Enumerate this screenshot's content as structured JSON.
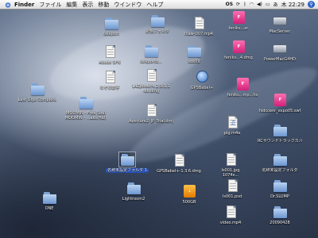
{
  "menubar": {
    "apple": "",
    "app": "Finder",
    "menus": [
      "ファイル",
      "編集",
      "表示",
      "移動",
      "ウインドウ",
      "ヘルプ"
    ],
    "status_os": "OS",
    "clock": "木 22:29"
  },
  "desktop": {
    "icons": [
      {
        "name": "teleport",
        "label": "teleport",
        "kind": "folder"
      },
      {
        "name": "new-folder",
        "label": "新規フォルダ",
        "kind": "folder"
      },
      {
        "name": "hiawatha",
        "label": "hiaw-007.mp4",
        "kind": "doc"
      },
      {
        "name": "file-1",
        "label": "feniks...ar",
        "kind": "pink"
      },
      {
        "name": "macserver",
        "label": "MacServer",
        "kind": "drive"
      },
      {
        "name": "adobe-sfn",
        "label": "Adobe SFN",
        "kind": "doc"
      },
      {
        "name": "teleportdir",
        "label": "teleportd...",
        "kind": "folder"
      },
      {
        "name": "sdk09",
        "label": "sdk09",
        "kind": "folder"
      },
      {
        "name": "file-2",
        "label": "feniks...4.dmg",
        "kind": "pink"
      },
      {
        "name": "powermac",
        "label": "PowerMacG4HD",
        "kind": "drive"
      },
      {
        "name": "nazo",
        "label": "なぞの数字",
        "kind": "doc"
      },
      {
        "name": "l4zpower",
        "label": "L4Zpower4.2.9.1.1\n-xk.dmg",
        "kind": "doc"
      },
      {
        "name": "gpsbabel",
        "label": "GPSBabel+",
        "kind": "app"
      },
      {
        "name": "file-3",
        "label": "feniks...mp...hs",
        "kind": "pink"
      },
      {
        "name": "last-gigs",
        "label": "Last Gigs Complete",
        "kind": "folder"
      },
      {
        "name": "moomin",
        "label": "MOOMIN - Free Soul\nMOOMIN - ...aks(Hal)",
        "kind": "folder"
      },
      {
        "name": "aperture",
        "label": "Aperture2_JP_Trial.dmg",
        "kind": "doc"
      },
      {
        "name": "hidcenr",
        "label": "hidccenr_expo05.swf",
        "kind": "pink"
      },
      {
        "name": "pigm4a",
        "label": "pig.m4a",
        "kind": "audio"
      },
      {
        "name": "rc-cover",
        "label": "RCサウンドトラックカバーズ",
        "kind": "folder"
      },
      {
        "name": "untitled",
        "label": "名称未設定フォルダ 1",
        "kind": "folder",
        "selected": true
      },
      {
        "name": "gpsbabel-dmg",
        "label": "GPSBabel+-1.3.6.dmg",
        "kind": "doc"
      },
      {
        "name": "ls001jpg",
        "label": "ls001.jpg\n1074x...",
        "kind": "doc"
      },
      {
        "name": "untitled-2",
        "label": "名称未設定フォルダ",
        "kind": "folder"
      },
      {
        "name": "lightroom",
        "label": "Lightroom2",
        "kind": "folder"
      },
      {
        "name": "500gb",
        "label": "500GB",
        "kind": "drive-orange"
      },
      {
        "name": "ls001psd",
        "label": "ls001.psd",
        "kind": "doc"
      },
      {
        "name": "drslump",
        "label": "Dr.SLUMP",
        "kind": "folder"
      },
      {
        "name": "one",
        "label": "ONE",
        "kind": "folder"
      },
      {
        "name": "video",
        "label": "video.mp4",
        "kind": "doc"
      },
      {
        "name": "20090428",
        "label": "20090428",
        "kind": "folder"
      }
    ]
  }
}
